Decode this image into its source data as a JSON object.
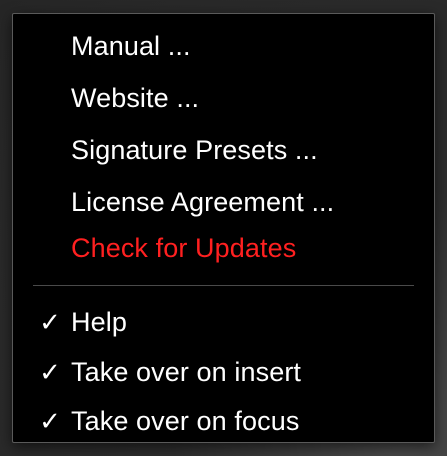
{
  "menu": {
    "items": [
      {
        "label": "Manual ..."
      },
      {
        "label": "Website ..."
      },
      {
        "label": "Signature Presets ..."
      },
      {
        "label": "License Agreement ..."
      },
      {
        "label": "Check for Updates"
      }
    ],
    "toggles": [
      {
        "label": "Help",
        "checked": true,
        "mark": "✓"
      },
      {
        "label": "Take over on insert",
        "checked": true,
        "mark": "✓"
      },
      {
        "label": "Take over on focus",
        "checked": true,
        "mark": "✓"
      }
    ]
  },
  "colors": {
    "menu_background": "#000000",
    "text": "#ffffff",
    "update_highlight": "#ff2020"
  }
}
